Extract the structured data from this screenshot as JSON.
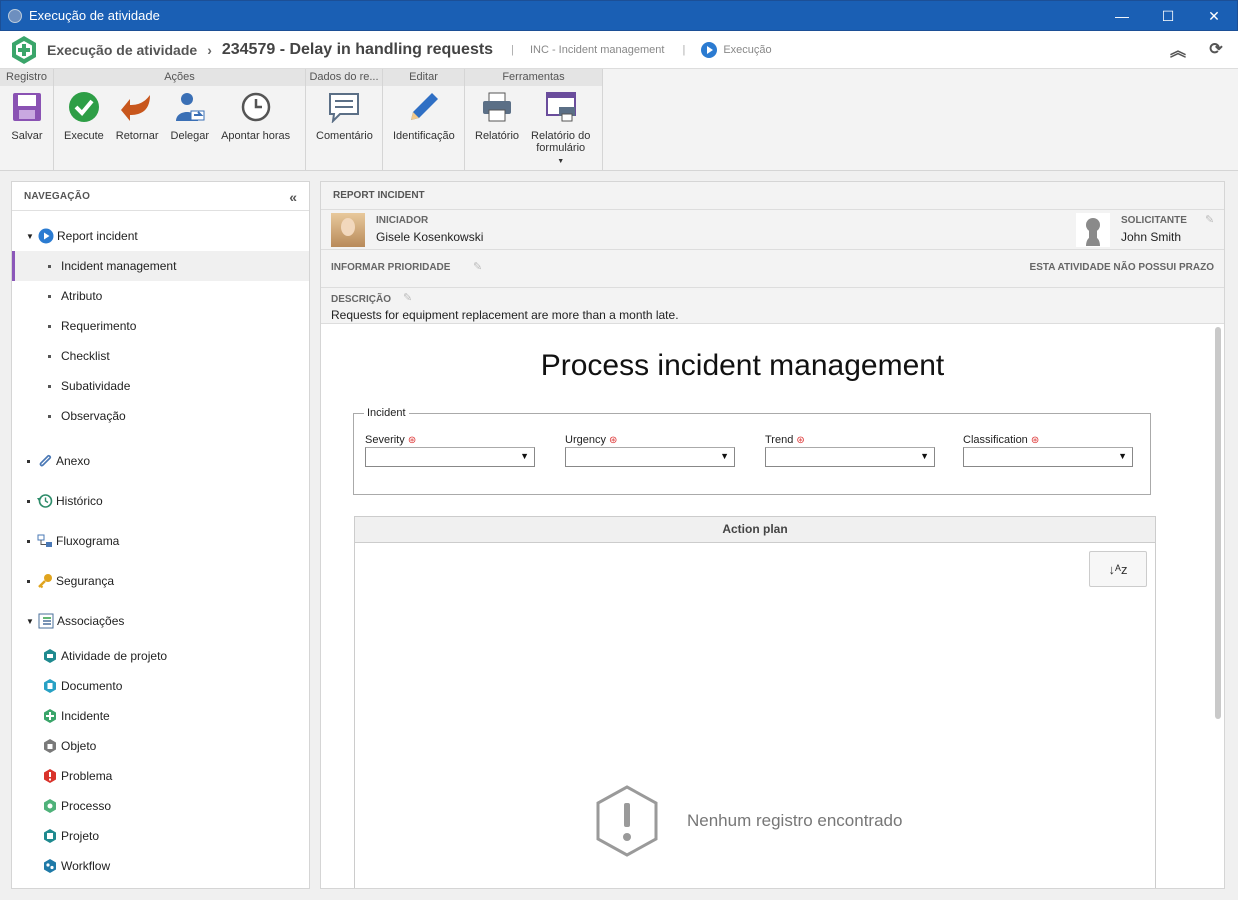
{
  "window": {
    "title": "Execução de atividade",
    "buttons": {
      "minimize": "—",
      "maximize": "☐",
      "close": "✕"
    }
  },
  "header": {
    "crumb_module": "Execução de atividade",
    "crumb_activity": "234579 - Delay in handling requests",
    "crumb_process": "INC - Incident management",
    "crumb_status": "Execução",
    "separator": "|"
  },
  "ribbon": {
    "groups": [
      {
        "title": "Registro",
        "buttons": [
          {
            "label": "Salvar",
            "icon": "save-icon"
          }
        ]
      },
      {
        "title": "Ações",
        "buttons": [
          {
            "label": "Execute",
            "icon": "check-icon"
          },
          {
            "label": "Retornar",
            "icon": "return-arrow-icon"
          },
          {
            "label": "Delegar",
            "icon": "delegate-icon"
          },
          {
            "label": "Apontar horas",
            "icon": "clock-icon"
          }
        ]
      },
      {
        "title": "Dados do re...",
        "buttons": [
          {
            "label": "Comentário",
            "icon": "comment-icon"
          }
        ]
      },
      {
        "title": "Editar",
        "buttons": [
          {
            "label": "Identificação",
            "icon": "pencil-icon"
          }
        ]
      },
      {
        "title": "Ferramentas",
        "buttons": [
          {
            "label": "Relatório",
            "icon": "printer-icon"
          },
          {
            "label": "Relatório do",
            "label2": "formulário",
            "icon": "form-report-icon"
          }
        ]
      }
    ]
  },
  "nav": {
    "title": "NAVEGAÇÃO",
    "collapse": "«",
    "report_incident": "Report incident",
    "sub_items": [
      "Incident management",
      "Atributo",
      "Requerimento",
      "Checklist",
      "Subatividade",
      "Observação"
    ],
    "items": [
      "Anexo",
      "Histórico",
      "Fluxograma",
      "Segurança"
    ],
    "associacoes": "Associações",
    "assoc_items": [
      "Atividade de projeto",
      "Documento",
      "Incidente",
      "Objeto",
      "Problema",
      "Processo",
      "Projeto",
      "Workflow"
    ]
  },
  "content": {
    "title": "REPORT INCIDENT",
    "iniciador_label": "INICIADOR",
    "iniciador_name": "Gisele Kosenkowski",
    "solicitante_label": "SOLICITANTE",
    "solicitante_name": "John Smith",
    "prioridade_label": "INFORMAR PRIORIDADE",
    "prazo_text": "ESTA ATIVIDADE NÃO POSSUI PRAZO",
    "descricao_label": "DESCRIÇÃO",
    "descricao_text": "Requests for equipment replacement are more than a month late."
  },
  "form": {
    "title": "Process incident management",
    "fieldset_legend": "Incident",
    "fields": [
      "Severity",
      "Urgency",
      "Trend",
      "Classification"
    ],
    "required_mark": "⊛",
    "action_plan_title": "Action plan",
    "sort_label": "↓ᴬz",
    "empty_text": "Nenhum registro encontrado"
  },
  "colors": {
    "titlebar": "#1a5fb4",
    "selected_accent": "#8b57b9",
    "execute_green": "#2e9e46",
    "return_orange": "#c8561c",
    "exec_blue": "#2b7bd1"
  }
}
